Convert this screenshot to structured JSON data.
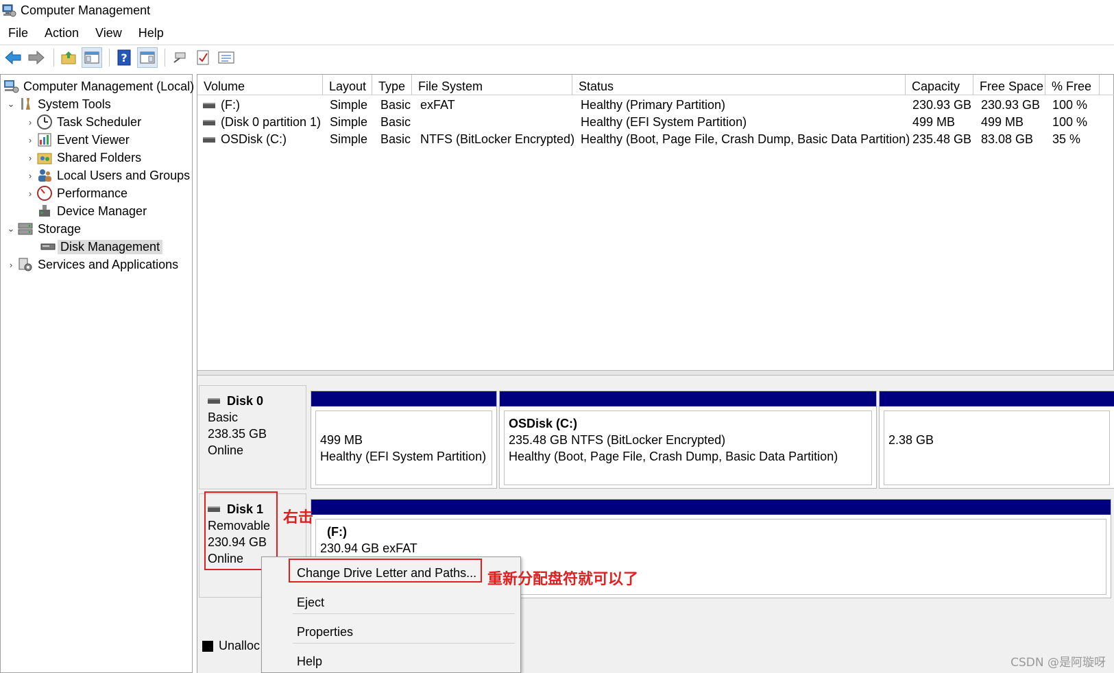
{
  "window": {
    "title": "Computer Management",
    "icon": "computer-management-icon"
  },
  "menu": [
    "File",
    "Action",
    "View",
    "Help"
  ],
  "toolbar": {
    "icons": [
      "back-arrow-icon",
      "forward-arrow-icon",
      "up-folder-icon",
      "show-hide-tree-icon",
      "help-icon",
      "show-hide-action-pane-icon",
      "connect-icon",
      "checklist-icon",
      "properties-list-icon"
    ]
  },
  "tree": {
    "root": "Computer Management (Local)",
    "system_tools": "System Tools",
    "task_scheduler": "Task Scheduler",
    "event_viewer": "Event Viewer",
    "shared_folders": "Shared Folders",
    "local_users": "Local Users and Groups",
    "performance": "Performance",
    "device_manager": "Device Manager",
    "storage": "Storage",
    "disk_management": "Disk Management",
    "services_apps": "Services and Applications"
  },
  "volumes": {
    "headers": {
      "volume": "Volume",
      "layout": "Layout",
      "type": "Type",
      "fs": "File System",
      "status": "Status",
      "capacity": "Capacity",
      "free": "Free Space",
      "pct": "% Free"
    },
    "rows": [
      {
        "volume": "(F:)",
        "layout": "Simple",
        "type": "Basic",
        "fs": "exFAT",
        "status": "Healthy (Primary Partition)",
        "capacity": "230.93 GB",
        "free": "230.93 GB",
        "pct": "100 %"
      },
      {
        "volume": "(Disk 0 partition 1)",
        "layout": "Simple",
        "type": "Basic",
        "fs": "",
        "status": "Healthy (EFI System Partition)",
        "capacity": "499 MB",
        "free": "499 MB",
        "pct": "100 %"
      },
      {
        "volume": "OSDisk (C:)",
        "layout": "Simple",
        "type": "Basic",
        "fs": "NTFS (BitLocker Encrypted)",
        "status": "Healthy (Boot, Page File, Crash Dump, Basic Data Partition)",
        "capacity": "235.48 GB",
        "free": "83.08 GB",
        "pct": "35 %"
      }
    ]
  },
  "disks": {
    "disk0": {
      "name": "Disk 0",
      "type": "Basic",
      "size": "238.35 GB",
      "status": "Online",
      "p1": {
        "size": "499 MB",
        "status": "Healthy (EFI System Partition)"
      },
      "p2": {
        "name": "OSDisk  (C:)",
        "info": "235.48 GB NTFS (BitLocker Encrypted)",
        "status": "Healthy (Boot, Page File, Crash Dump, Basic Data Partition)"
      },
      "p3": {
        "size": "2.38 GB"
      }
    },
    "disk1": {
      "name": "Disk 1",
      "type": "Removable",
      "size": "230.94 GB",
      "status": "Online",
      "p1": {
        "name": "(F:)",
        "info": "230.94 GB exFAT",
        "status": "Healthy (Primary Partition)"
      }
    }
  },
  "legend": {
    "unallocated": "Unalloc"
  },
  "context_menu": [
    "Change Drive Letter and Paths...",
    "Eject",
    "Properties",
    "Help"
  ],
  "annotations": {
    "right_click": "右击",
    "reassign": "重新分配盘符就可以了"
  },
  "watermark": "CSDN @是阿璇呀",
  "colors": {
    "partition_bar": "#00007f",
    "annotation": "#e02020"
  }
}
